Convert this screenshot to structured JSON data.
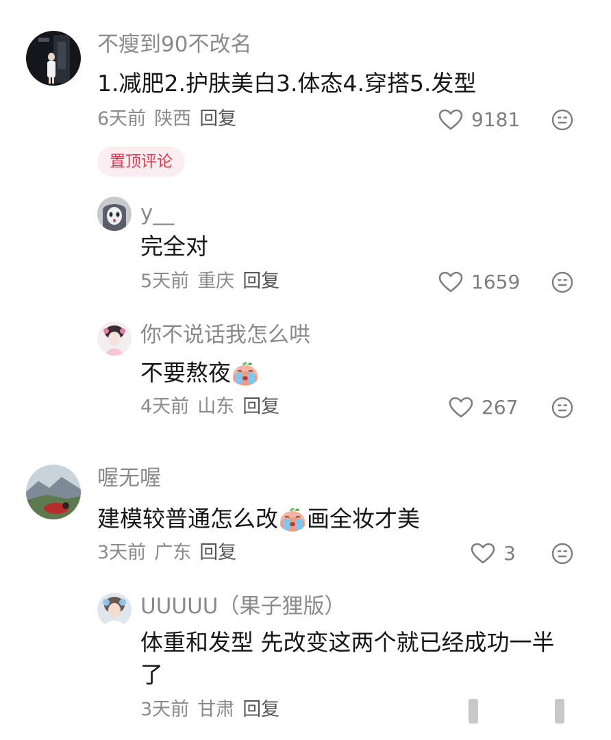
{
  "comments": [
    {
      "username": "不瘦到90不改名",
      "text": "1.减肥2.护肤美白3.体态4.穿搭5.发型",
      "time": "6天前",
      "location": "陕西",
      "reply_label": "回复",
      "likes": "9181",
      "badge": "置顶评论"
    },
    {
      "username": "y__",
      "text": "完全对",
      "time": "5天前",
      "location": "重庆",
      "reply_label": "回复",
      "likes": "1659"
    },
    {
      "username": "你不说话我怎么哄",
      "text": "不要熬夜",
      "time": "4天前",
      "location": "山东",
      "reply_label": "回复",
      "likes": "267"
    },
    {
      "username": "喔无喔",
      "text_before_emoji": "建模较普通怎么改",
      "text_after_emoji": "画全妆才美",
      "time": "3天前",
      "location": "广东",
      "reply_label": "回复",
      "likes": "3"
    },
    {
      "username": "UUUUU（果子狸版）",
      "text_line1": "体重和发型 先改变这两个就已经成功一半",
      "text_line2": "了",
      "time": "3天前",
      "location": "甘肃",
      "reply_label": "回复"
    }
  ],
  "icons": {
    "like": "heart-outline-icon",
    "dislike": "neutral-face-icon",
    "emoji": "crying-peach-emoji"
  },
  "colors": {
    "pinned_badge_text": "#e8364f",
    "pinned_badge_bg": "#fbeef0",
    "muted_text": "#8a8a8a"
  }
}
